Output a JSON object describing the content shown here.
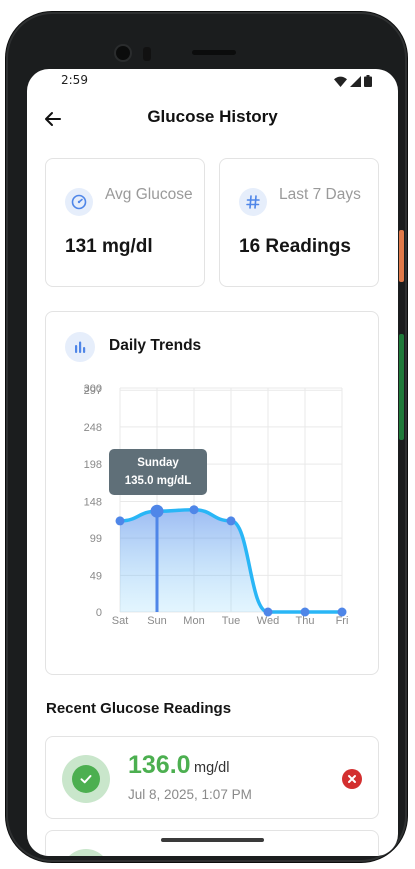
{
  "status_bar": {
    "time": "2:59"
  },
  "header": {
    "title": "Glucose History"
  },
  "stats": [
    {
      "icon": "speedometer-icon",
      "label": "Avg Glucose",
      "value": "131 mg/dl"
    },
    {
      "icon": "hash-icon",
      "label": "Last 7 Days",
      "value": "16 Readings"
    }
  ],
  "trends": {
    "title": "Daily Trends",
    "icon": "bar-chart-icon"
  },
  "chart_data": {
    "type": "area",
    "categories": [
      "Sat",
      "Sun",
      "Mon",
      "Tue",
      "Wed",
      "Thu",
      "Fri"
    ],
    "values": [
      122,
      135,
      137,
      122,
      0,
      0,
      0
    ],
    "y_ticks": [
      "300",
      "297",
      "248",
      "198",
      "148",
      "99",
      "49",
      "0"
    ],
    "ylim": [
      0,
      300
    ],
    "grid": true,
    "line_color": "#29b6f6",
    "point_color": "#4f86e8",
    "tooltip": {
      "title": "Sunday",
      "value": "135.0 mg/dL",
      "index": 1
    }
  },
  "recent": {
    "title": "Recent Glucose Readings",
    "items": [
      {
        "value": "136.0",
        "unit": "mg/dl",
        "timestamp": "Jul 8, 2025, 1:07 PM",
        "status_color": "#4caf50"
      }
    ]
  },
  "colors": {
    "accent": "#4f86e8",
    "success": "#4caf50",
    "danger": "#d32f2f"
  }
}
